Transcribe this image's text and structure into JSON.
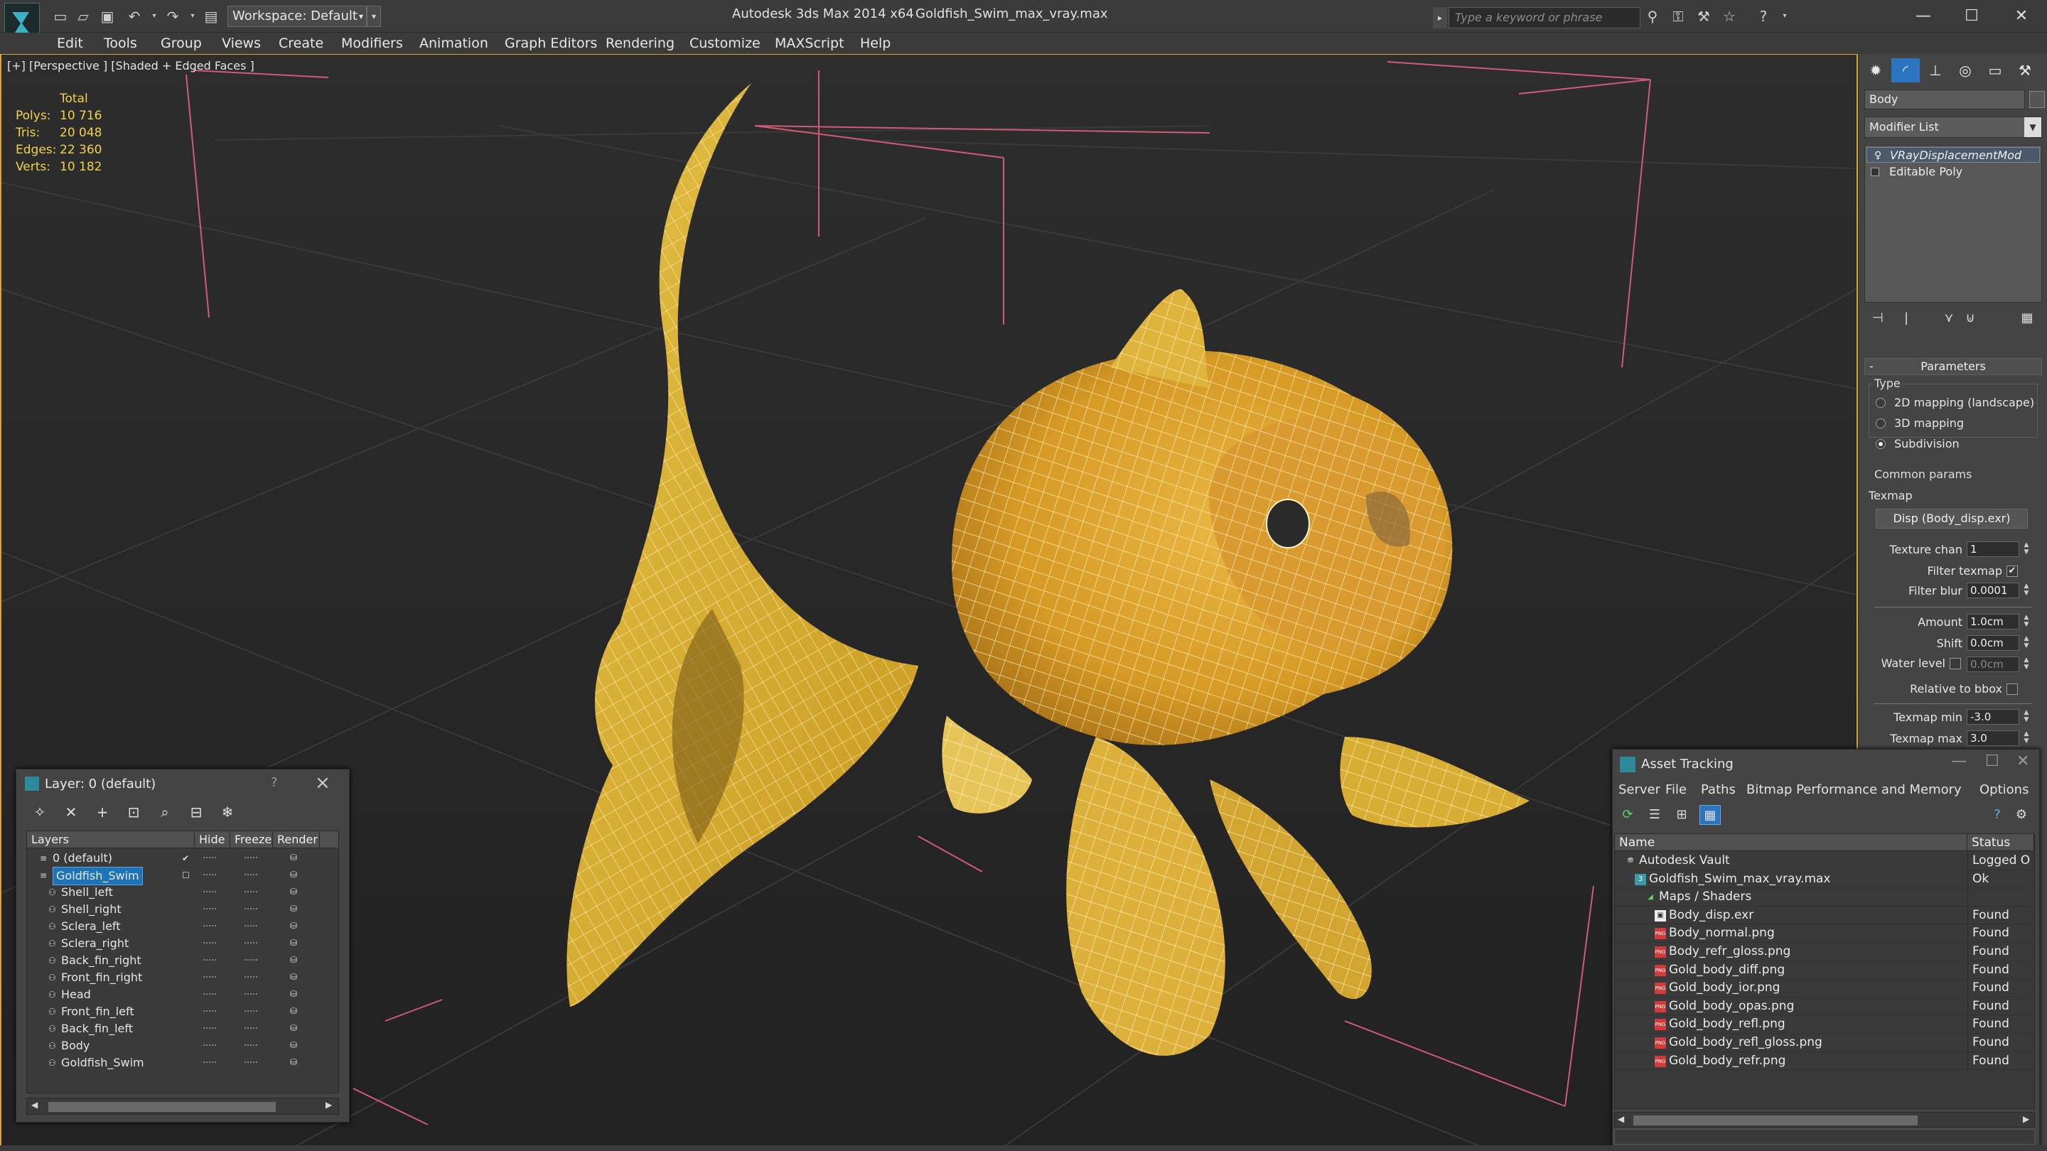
{
  "titlebar": {
    "workspace": "Workspace: Default",
    "app_title": "Autodesk 3ds Max  2014 x64",
    "doc_title": "Goldfish_Swim_max_vray.max",
    "search_placeholder": "Type a keyword or phrase"
  },
  "menu": [
    "Edit",
    "Tools",
    "Group",
    "Views",
    "Create",
    "Modifiers",
    "Animation",
    "Graph Editors",
    "Rendering",
    "Customize",
    "MAXScript",
    "Help"
  ],
  "viewport": {
    "label": "[+] [Perspective ] [Shaded + Edged Faces ]",
    "stats": {
      "header": "Total",
      "rows": [
        {
          "k": "Polys:",
          "v": "10 716"
        },
        {
          "k": "Tris:",
          "v": "20 048"
        },
        {
          "k": "Edges:",
          "v": "22 360"
        },
        {
          "k": "Verts:",
          "v": "10 182"
        }
      ]
    }
  },
  "command_panel": {
    "object_name": "Body",
    "modifier_list": "Modifier List",
    "stack": [
      "VRayDisplacementMod",
      "Editable Poly"
    ],
    "rollout_title": "Parameters",
    "type_group": "Type",
    "type_options": [
      "2D mapping (landscape)",
      "3D mapping",
      "Subdivision"
    ],
    "type_selected": 2,
    "common_group": "Common params",
    "texmap_label": "Texmap",
    "texmap_button": "Disp (Body_disp.exr)",
    "texture_chan_label": "Texture chan",
    "texture_chan_value": "1",
    "filter_texmap_label": "Filter texmap",
    "filter_texmap_checked": "✔",
    "filter_blur_label": "Filter blur",
    "filter_blur_value": "0.0001",
    "amount_label": "Amount",
    "amount_value": "1.0cm",
    "shift_label": "Shift",
    "shift_value": "0.0cm",
    "water_level_label": "Water level",
    "water_level_value": "0.0cm",
    "relative_label": "Relative to bbox",
    "texmap_min_label": "Texmap min",
    "texmap_min_value": "-3.0",
    "texmap_max_label": "Texmap max",
    "texmap_max_value": "3.0"
  },
  "layer_window": {
    "title": "Layer: 0 (default)",
    "help": "?",
    "columns": [
      "Layers",
      "Hide",
      "Freeze",
      "Render"
    ],
    "rows": [
      {
        "name": "0 (default)",
        "indent": 1,
        "layer": true
      },
      {
        "name": "Goldfish_Swim",
        "indent": 1,
        "layer": true
      },
      {
        "name": "Shell_left",
        "indent": 2,
        "layer": false
      },
      {
        "name": "Shell_right",
        "indent": 2,
        "layer": false
      },
      {
        "name": "Sclera_left",
        "indent": 2,
        "layer": false
      },
      {
        "name": "Sclera_right",
        "indent": 2,
        "layer": false
      },
      {
        "name": "Back_fin_right",
        "indent": 2,
        "layer": false
      },
      {
        "name": "Front_fin_right",
        "indent": 2,
        "layer": false
      },
      {
        "name": "Head",
        "indent": 2,
        "layer": false
      },
      {
        "name": "Front_fin_left",
        "indent": 2,
        "layer": false
      },
      {
        "name": "Back_fin_left",
        "indent": 2,
        "layer": false
      },
      {
        "name": "Body",
        "indent": 2,
        "layer": false
      },
      {
        "name": "Goldfish_Swim",
        "indent": 2,
        "layer": false
      }
    ]
  },
  "asset_window": {
    "title": "Asset Tracking",
    "menu": [
      "Server",
      "File",
      "Paths",
      "Bitmap Performance and Memory",
      "Options"
    ],
    "columns": [
      "Name",
      "Status"
    ],
    "rows": [
      {
        "name": "Autodesk Vault",
        "status": "Logged O",
        "indent": 0,
        "kind": "vault"
      },
      {
        "name": "Goldfish_Swim_max_vray.max",
        "status": "Ok",
        "indent": 1,
        "kind": "max"
      },
      {
        "name": "Maps / Shaders",
        "status": "",
        "indent": 2,
        "kind": "maps"
      },
      {
        "name": "Body_disp.exr",
        "status": "Found",
        "indent": 3,
        "kind": "exr"
      },
      {
        "name": "Body_normal.png",
        "status": "Found",
        "indent": 3,
        "kind": "png"
      },
      {
        "name": "Body_refr_gloss.png",
        "status": "Found",
        "indent": 3,
        "kind": "png"
      },
      {
        "name": "Gold_body_diff.png",
        "status": "Found",
        "indent": 3,
        "kind": "png"
      },
      {
        "name": "Gold_body_ior.png",
        "status": "Found",
        "indent": 3,
        "kind": "png"
      },
      {
        "name": "Gold_body_opas.png",
        "status": "Found",
        "indent": 3,
        "kind": "png"
      },
      {
        "name": "Gold_body_refl.png",
        "status": "Found",
        "indent": 3,
        "kind": "png"
      },
      {
        "name": "Gold_body_refl_gloss.png",
        "status": "Found",
        "indent": 3,
        "kind": "png"
      },
      {
        "name": "Gold_body_refr.png",
        "status": "Found",
        "indent": 3,
        "kind": "png"
      }
    ]
  },
  "colors": {
    "accent": "#1f74b8",
    "stats": "#f1d24a",
    "viewport_border": "#d5a43a",
    "fish": "#e0b832",
    "wire": "#fff3b0"
  }
}
